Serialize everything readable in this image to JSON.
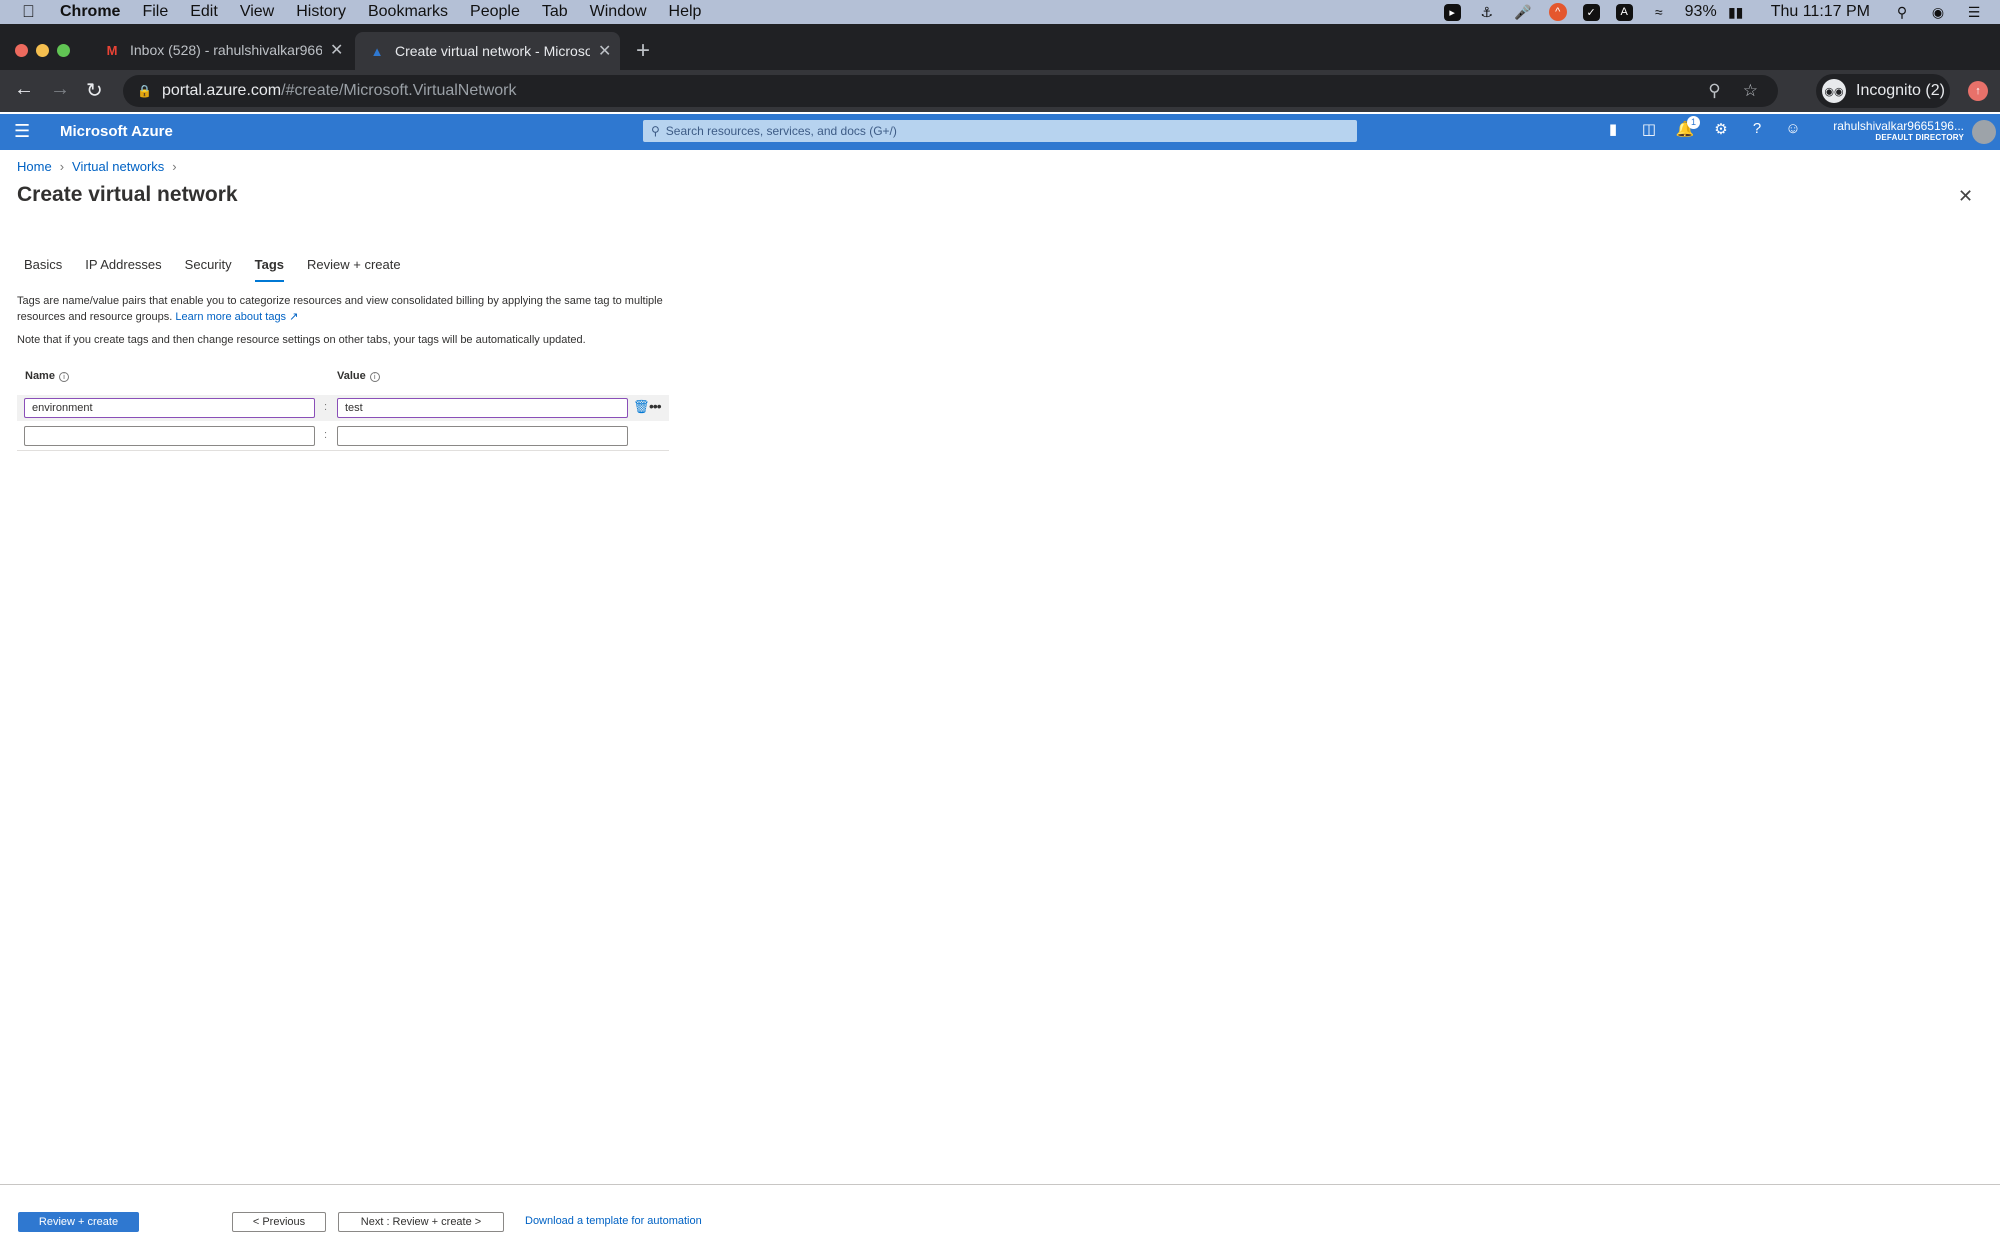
{
  "menubar": {
    "app": "Chrome",
    "items": [
      "File",
      "Edit",
      "View",
      "History",
      "Bookmarks",
      "People",
      "Tab",
      "Window",
      "Help"
    ],
    "battery": "93%",
    "clock": "Thu 11:17 PM",
    "status_icons": [
      "zoom-icon",
      "docker-icon",
      "microphone-icon",
      "orange-up-icon",
      "check-icon",
      "a-icon",
      "wifi-icon",
      "battery-icon",
      "spotlight-icon",
      "siri-icon",
      "control-center-icon"
    ]
  },
  "browser": {
    "tabs": [
      {
        "title": "Inbox (528) - rahulshivalkar966",
        "icon": "gmail-icon",
        "active": false
      },
      {
        "title": "Create virtual network - Microsoft Azure",
        "icon": "azure-icon",
        "active": true
      }
    ],
    "url_host": "portal.azure.com",
    "url_path": "/#create/Microsoft.VirtualNetwork",
    "profile_label": "Incognito (2)"
  },
  "azure": {
    "brand": "Microsoft Azure",
    "search_placeholder": "Search resources, services, and docs (G+/)",
    "notification_count": "1",
    "user": "rahulshivalkar9665196...",
    "directory": "DEFAULT DIRECTORY"
  },
  "page": {
    "breadcrumb": [
      "Home",
      "Virtual networks"
    ],
    "title": "Create virtual network",
    "tabs": [
      {
        "label": "Basics",
        "active": false
      },
      {
        "label": "IP Addresses",
        "active": false
      },
      {
        "label": "Security",
        "active": false
      },
      {
        "label": "Tags",
        "active": true
      },
      {
        "label": "Review + create",
        "active": false
      }
    ],
    "description": "Tags are name/value pairs that enable you to categorize resources and view consolidated billing by applying the same tag to multiple resources and resource groups.",
    "learn_more": "Learn more about tags",
    "note": "Note that if you create tags and then change resource settings on other tabs, your tags will be automatically updated.",
    "tags_table": {
      "name_header": "Name",
      "value_header": "Value",
      "separator": ":",
      "rows": [
        {
          "name": "environment",
          "value": "test"
        },
        {
          "name": "",
          "value": ""
        }
      ]
    }
  },
  "footer": {
    "review_create": "Review + create",
    "previous": "< Previous",
    "next": "Next : Review + create >",
    "download": "Download a template for automation"
  }
}
